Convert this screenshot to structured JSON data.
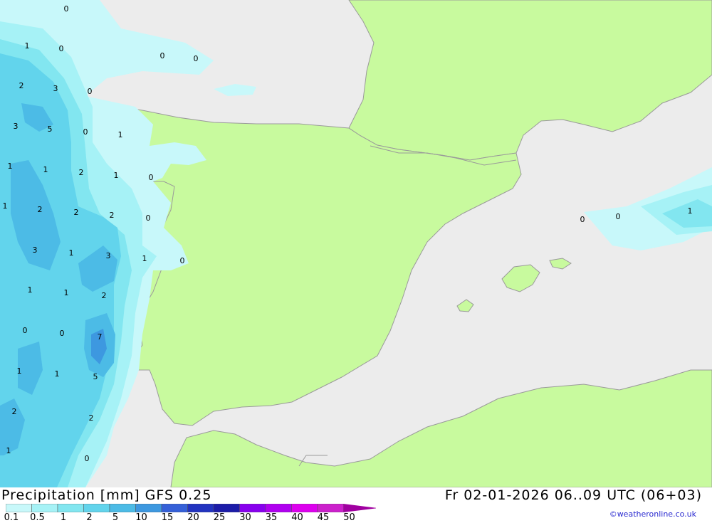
{
  "header": {
    "product": "Precipitation [mm] GFS 0.25",
    "valid_time": "Fr 02-01-2026 06..09 UTC (06+03)",
    "credit": "©weatheronline.co.uk"
  },
  "colors": {
    "sea": "#ececec",
    "land": "#c8fa9e",
    "border": "#9a9a9a"
  },
  "legend": {
    "labels": [
      "0.1",
      "0.5",
      "1",
      "2",
      "5",
      "10",
      "15",
      "20",
      "25",
      "30",
      "35",
      "40",
      "45",
      "50"
    ],
    "colors": [
      "#c8f8fa",
      "#a6f2f6",
      "#82e6f0",
      "#62d4ec",
      "#4cbbe6",
      "#3d98e0",
      "#3560d8",
      "#2233c0",
      "#1c1ca8",
      "#8800ee",
      "#b000f0",
      "#dd00ee",
      "#cc20cc",
      "#a000a0"
    ]
  },
  "values": [
    {
      "t": "0"
    },
    {
      "t": "1"
    },
    {
      "t": "0"
    },
    {
      "t": "0"
    },
    {
      "t": "0"
    },
    {
      "t": "2"
    },
    {
      "t": "3"
    },
    {
      "t": "0"
    },
    {
      "t": "3"
    },
    {
      "t": "5"
    },
    {
      "t": "0"
    },
    {
      "t": "1"
    },
    {
      "t": "1"
    },
    {
      "t": "1"
    },
    {
      "t": "2"
    },
    {
      "t": "1"
    },
    {
      "t": "0"
    },
    {
      "t": "1"
    },
    {
      "t": "2"
    },
    {
      "t": "2"
    },
    {
      "t": "2"
    },
    {
      "t": "0"
    },
    {
      "t": "3"
    },
    {
      "t": "1"
    },
    {
      "t": "3"
    },
    {
      "t": "1"
    },
    {
      "t": "0"
    },
    {
      "t": "1"
    },
    {
      "t": "1"
    },
    {
      "t": "2"
    },
    {
      "t": "0"
    },
    {
      "t": "0"
    },
    {
      "t": "7"
    },
    {
      "t": "1"
    },
    {
      "t": "1"
    },
    {
      "t": "5"
    },
    {
      "t": "2"
    },
    {
      "t": "2"
    },
    {
      "t": "1"
    },
    {
      "t": "0"
    },
    {
      "t": "0"
    },
    {
      "t": "0"
    },
    {
      "t": "1"
    }
  ]
}
